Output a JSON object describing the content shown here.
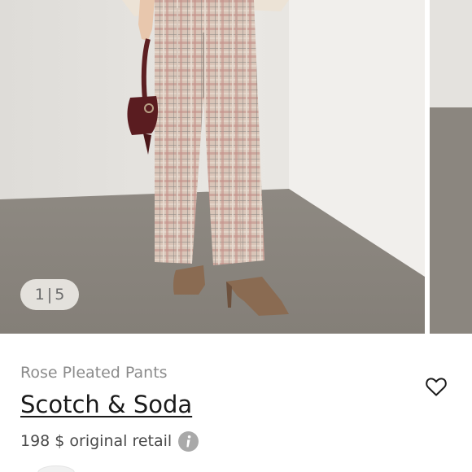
{
  "carousel": {
    "current": "1",
    "separator": "|",
    "total": "5",
    "images": [
      {
        "alt": "photo-model-plaid-pants"
      },
      {
        "alt": "photo-next-preview"
      }
    ]
  },
  "product": {
    "name": "Rose Pleated Pants",
    "brand": "Scotch & Soda",
    "price": "198 $",
    "price_note": "original retail"
  },
  "icons": {
    "favorite": "heart-outline-icon",
    "info": "info-icon"
  },
  "colors": {
    "brand_text": "#1a1a1a",
    "muted_text": "#8b8b8b",
    "info_icon_bg": "#a9a9a9"
  }
}
